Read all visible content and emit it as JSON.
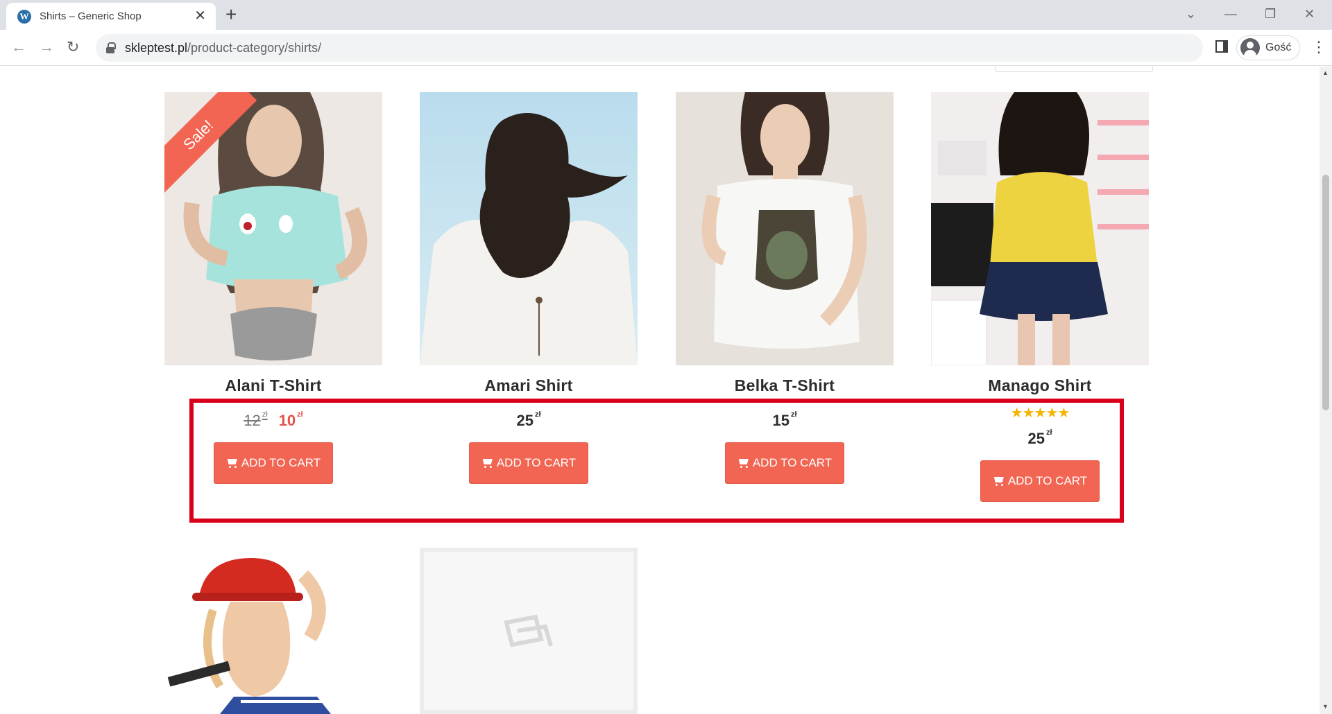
{
  "browser": {
    "tab_title": "Shirts – Generic Shop",
    "favicon_letter": "W",
    "url_domain": "skleptest.pl",
    "url_path": "/product-category/shirts/",
    "profile_name": "Gość"
  },
  "products": [
    {
      "title": "Alani T-Shirt",
      "regular_price": "12",
      "sale_price": "10",
      "currency": "zł",
      "sale_badge": "Sale!",
      "button": "ADD TO CART"
    },
    {
      "title": "Amari Shirt",
      "price": "25",
      "currency": "zł",
      "button": "ADD TO CART"
    },
    {
      "title": "Belka T-Shirt",
      "price": "15",
      "currency": "zł",
      "button": "ADD TO CART"
    },
    {
      "title": "Manago Shirt",
      "price": "25",
      "currency": "zł",
      "rating": 5,
      "button": "ADD TO CART"
    }
  ],
  "colors": {
    "accent": "#f26552",
    "highlight": "#d8001a",
    "stars": "#f4b400"
  }
}
